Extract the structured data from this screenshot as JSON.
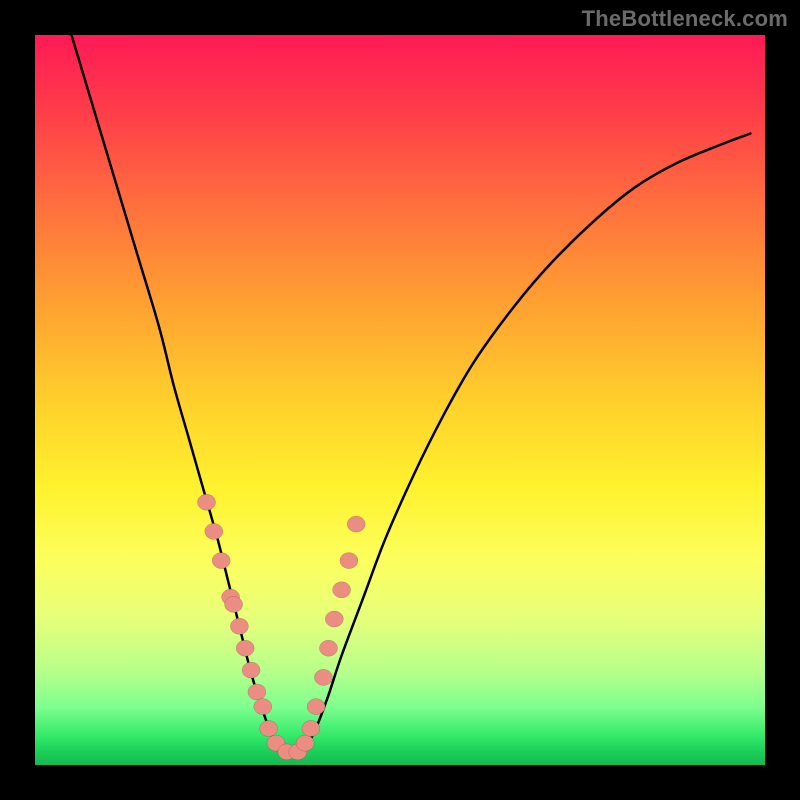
{
  "watermark": "TheBottleneck.com",
  "chart_data": {
    "type": "line",
    "title": "",
    "xlabel": "",
    "ylabel": "",
    "xlim": [
      0,
      100
    ],
    "ylim": [
      0,
      100
    ],
    "curve": {
      "name": "bottleneck-curve",
      "x": [
        5,
        8,
        11,
        14,
        17,
        19,
        21,
        23,
        25,
        26.5,
        28,
        29.5,
        31,
        32.5,
        34,
        36,
        38,
        40,
        42,
        45,
        48,
        52,
        56,
        60,
        65,
        70,
        76,
        82,
        88,
        94,
        98
      ],
      "y": [
        100,
        90,
        80,
        70,
        60,
        52,
        45,
        38,
        31,
        25,
        19,
        13,
        8,
        4,
        1.5,
        1.5,
        4,
        9,
        15,
        23,
        31,
        40,
        48,
        55,
        62,
        68,
        74,
        79,
        82.5,
        85,
        86.5
      ]
    },
    "markers": {
      "name": "sample-points",
      "x": [
        23.5,
        24.5,
        25.5,
        26.8,
        27.2,
        28.0,
        28.8,
        29.6,
        30.4,
        31.2,
        32.0,
        33.0,
        34.5,
        36.0,
        37.0,
        37.8,
        38.5,
        39.5,
        40.2,
        41.0,
        42.0,
        43.0,
        44.0
      ],
      "y": [
        36,
        32,
        28,
        23,
        22,
        19,
        16,
        13,
        10,
        8,
        5,
        3,
        1.8,
        1.8,
        3,
        5,
        8,
        12,
        16,
        20,
        24,
        28,
        33
      ]
    },
    "background": "heatmap-gradient (red→orange→yellow→green top-to-bottom)"
  }
}
